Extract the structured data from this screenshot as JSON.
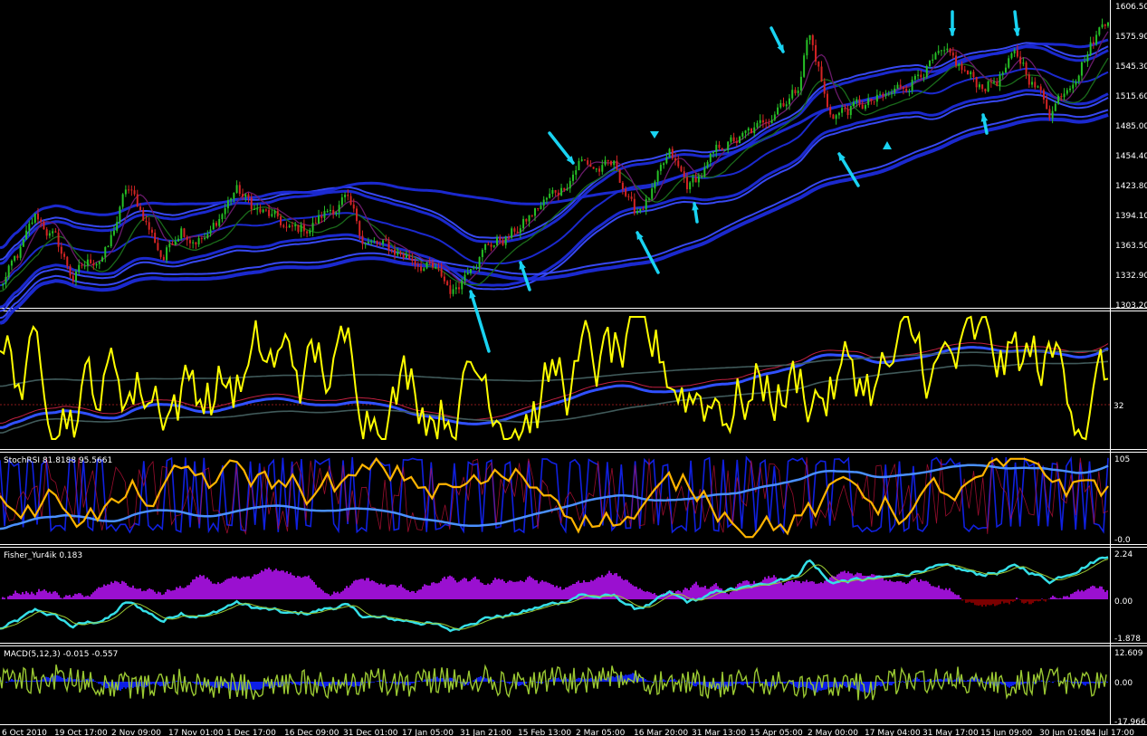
{
  "colors": {
    "background": "#000000",
    "grid": "#ffffff",
    "band": "#1c2bd9",
    "band_light": "#3a4cff",
    "arrow": "#19d3f2",
    "candle_up": "#26c026",
    "candle_down": "#d42424",
    "stoch": "#ffff00",
    "stochrsi": "#ffb400",
    "fisher_pos": "#9a10d0",
    "fisher_neg": "#7a0000",
    "fisher_line": "#35e0e8",
    "macd_hist": "#0c1ee6",
    "macd_signal": "#9ac832"
  },
  "price_panel": {
    "axis_labels": [
      "1606.50",
      "1575.90",
      "1545.30",
      "1515.60",
      "1485.00",
      "1454.40",
      "1423.80",
      "1394.10",
      "1363.50",
      "1332.90",
      "1303.20"
    ]
  },
  "stoch_panel": {
    "axis_labels": [
      "32"
    ]
  },
  "stochrsi_panel": {
    "title": "StochRSI 81.8188 95.5661",
    "axis_labels": [
      "105",
      "-0.0"
    ]
  },
  "fisher_panel": {
    "title": "Fisher_Yur4ik 0.183",
    "axis_labels": [
      "2.24",
      "0.00",
      "-1.878"
    ]
  },
  "macd_panel": {
    "title": "MACD(5,12,3) -0.015 -0.557",
    "axis_labels": [
      "12.609",
      "0.00",
      "-17.966"
    ]
  },
  "time_axis": {
    "labels": [
      "6 Oct 2010",
      "19 Oct 17:00",
      "2 Nov 09:00",
      "17 Nov 01:00",
      "1 Dec 17:00",
      "16 Dec 09:00",
      "31 Dec 01:00",
      "17 Jan 05:00",
      "31 Jan 21:00",
      "15 Feb 13:00",
      "2 Mar 05:00",
      "16 Mar 20:00",
      "31 Mar 13:00",
      "15 Apr 05:00",
      "2 May 00:00",
      "17 May 04:00",
      "31 May 17:00",
      "15 Jun 09:00",
      "30 Jun 01:00",
      "14 Jul 17:00"
    ]
  },
  "chart_data": {
    "type": "line",
    "title": "",
    "x_range": [
      "6 Oct 2010",
      "14 Jul 2011"
    ],
    "y_range": [
      1303.2,
      1606.5
    ],
    "price_path": {
      "x": [
        0,
        20,
        40,
        60,
        80,
        100,
        120,
        140,
        160,
        180,
        200,
        210,
        230,
        260,
        280,
        300,
        320,
        340,
        380,
        400,
        420,
        440,
        470,
        490,
        500,
        510,
        520,
        540,
        560,
        580,
        600,
        620,
        640,
        660,
        680,
        690,
        700,
        720,
        740,
        760,
        780,
        800,
        820,
        840,
        860,
        880,
        893,
        905,
        915,
        935,
        960,
        980,
        1000,
        1020,
        1040,
        1060,
        1080,
        1100,
        1120,
        1130,
        1150,
        1160,
        1180,
        1200,
        1220,
        1225
      ],
      "y": [
        1320,
        1350,
        1390,
        1370,
        1330,
        1345,
        1360,
        1420,
        1390,
        1350,
        1385,
        1375,
        1370,
        1420,
        1400,
        1390,
        1375,
        1380,
        1410,
        1370,
        1360,
        1355,
        1345,
        1325,
        1315,
        1330,
        1350,
        1365,
        1370,
        1385,
        1405,
        1420,
        1450,
        1440,
        1440,
        1420,
        1395,
        1415,
        1450,
        1420,
        1440,
        1465,
        1470,
        1480,
        1510,
        1520,
        1580,
        1540,
        1495,
        1500,
        1505,
        1510,
        1525,
        1545,
        1550,
        1540,
        1525,
        1530,
        1550,
        1545,
        1515,
        1500,
        1530,
        1560,
        1590,
        1600
      ]
    },
    "panels": [
      {
        "name": "price",
        "y_range": [
          1303.2,
          1606.5
        ]
      },
      {
        "name": "stochastic",
        "y_level": 32
      },
      {
        "name": "stochrsi",
        "values": [
          81.8188,
          95.5661
        ],
        "y_range": [
          0,
          105
        ]
      },
      {
        "name": "fisher",
        "value": 0.183,
        "y_range": [
          -1.878,
          2.24
        ]
      },
      {
        "name": "macd",
        "params": [
          5,
          12,
          3
        ],
        "values": [
          -0.015,
          -0.557
        ],
        "y_range": [
          -17.966,
          12.609
        ]
      }
    ],
    "grid": false
  }
}
